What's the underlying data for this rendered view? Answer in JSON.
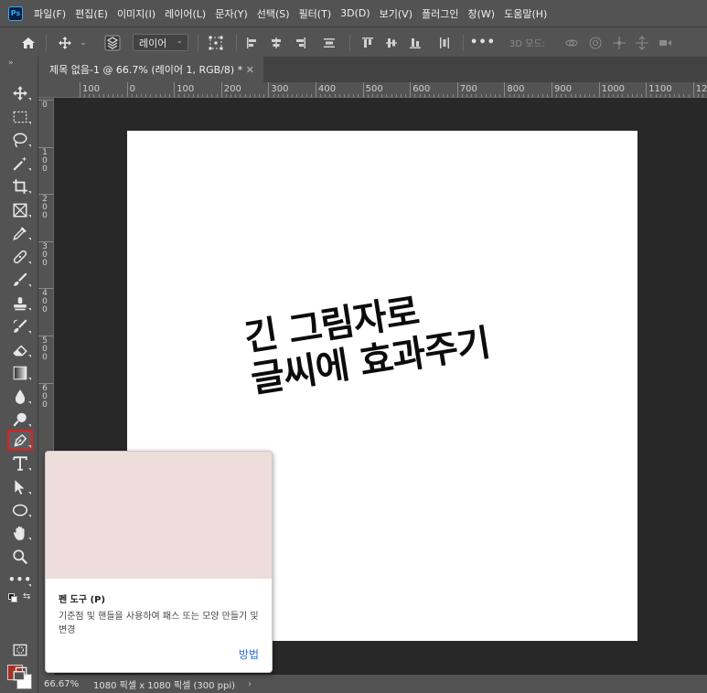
{
  "app": {
    "logo_text": "Ps"
  },
  "menubar": {
    "items": [
      "파일(F)",
      "편집(E)",
      "이미지(I)",
      "레이어(L)",
      "문자(Y)",
      "선택(S)",
      "필터(T)",
      "3D(D)",
      "보기(V)",
      "플러그인",
      "창(W)",
      "도움말(H)"
    ]
  },
  "options_bar": {
    "home_icon": "home-icon",
    "move_icon": "move-icon",
    "auto_select_value": "레이어",
    "mode_3d_label": "3D 모드:"
  },
  "toolbar": {
    "tools": [
      {
        "name": "move-tool",
        "icon": "move-icon"
      },
      {
        "name": "marquee-tool",
        "icon": "marquee-icon"
      },
      {
        "name": "lasso-tool",
        "icon": "lasso-icon"
      },
      {
        "name": "magic-wand-tool",
        "icon": "magic-wand-icon"
      },
      {
        "name": "crop-tool",
        "icon": "crop-icon"
      },
      {
        "name": "frame-tool",
        "icon": "frame-icon"
      },
      {
        "name": "eyedropper-tool",
        "icon": "eyedropper-icon"
      },
      {
        "name": "healing-brush-tool",
        "icon": "bandage-icon"
      },
      {
        "name": "brush-tool",
        "icon": "brush-icon"
      },
      {
        "name": "clone-stamp-tool",
        "icon": "stamp-icon"
      },
      {
        "name": "history-brush-tool",
        "icon": "history-brush-icon"
      },
      {
        "name": "eraser-tool",
        "icon": "eraser-icon"
      },
      {
        "name": "gradient-tool",
        "icon": "gradient-icon"
      },
      {
        "name": "blur-tool",
        "icon": "drop-icon"
      },
      {
        "name": "dodge-tool",
        "icon": "dodge-icon"
      },
      {
        "name": "pen-tool",
        "icon": "pen-icon"
      },
      {
        "name": "type-tool",
        "icon": "type-icon"
      },
      {
        "name": "path-selection-tool",
        "icon": "arrow-icon"
      },
      {
        "name": "ellipse-tool",
        "icon": "ellipse-icon"
      },
      {
        "name": "hand-tool",
        "icon": "hand-icon"
      },
      {
        "name": "zoom-tool",
        "icon": "zoom-icon"
      },
      {
        "name": "more-tools",
        "icon": "more-icon"
      }
    ],
    "foreground_color": "#a4302a",
    "background_color": "#ffffff"
  },
  "document": {
    "tab_title": "제목 없음-1 @ 66.7% (레이어 1, RGB/8) *",
    "headline_line1": "긴 그림자로",
    "headline_line2": "글씨에 효과주기"
  },
  "rulers": {
    "horizontal_labels": [
      "100",
      "0",
      "100",
      "200",
      "300",
      "400",
      "500",
      "600",
      "700",
      "800",
      "900",
      "1000",
      "1100",
      "12"
    ],
    "vertical_labels": [
      "0",
      "1 0 0",
      "2 0 0",
      "3 0 0",
      "4 0 0",
      "5 0 0",
      "6 0 0"
    ]
  },
  "tooltip": {
    "title": "펜 도구 (P)",
    "description": "기준점 및 핸들을 사용하여 패스 또는 모양 만들기 및 변경",
    "link": "방법",
    "preview_color": "#efdddb"
  },
  "statusbar": {
    "zoom": "66.67%",
    "doc_size": "1080 픽셀 x 1080 픽셀 (300 ppi)",
    "chevron": "›"
  }
}
